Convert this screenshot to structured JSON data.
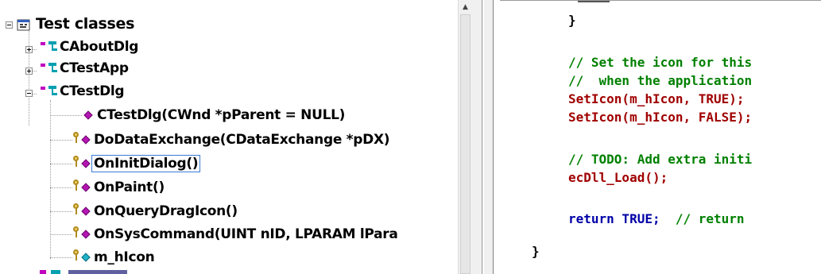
{
  "tree": {
    "root_label": "Test classes",
    "classes": [
      {
        "label": "CAboutDlg",
        "expanded": false
      },
      {
        "label": "CTestApp",
        "expanded": false
      },
      {
        "label": "CTestDlg",
        "expanded": true
      }
    ],
    "members": [
      {
        "label": "CTestDlg(CWnd *pParent = NULL)",
        "icon": "public-method-icon"
      },
      {
        "label": "DoDataExchange(CDataExchange *pDX)",
        "icon": "protected-method-icon"
      },
      {
        "label": "OnInitDialog()",
        "icon": "protected-method-icon",
        "selected": true
      },
      {
        "label": "OnPaint()",
        "icon": "protected-method-icon"
      },
      {
        "label": "OnQueryDragIcon()",
        "icon": "protected-method-icon"
      },
      {
        "label": "OnSysCommand(UINT nID, LPARAM lPara",
        "icon": "protected-method-icon"
      },
      {
        "label": "m_hIcon",
        "icon": "protected-variable-icon"
      }
    ]
  },
  "editor": {
    "lines": [
      {
        "text": "}",
        "kind": "plain"
      },
      {
        "text": "",
        "kind": "plain"
      },
      {
        "text": "// Set the icon for this",
        "kind": "comment"
      },
      {
        "text": "//  when the application",
        "kind": "comment"
      },
      {
        "text": "SetIcon(m_hIcon, TRUE);",
        "kind": "red"
      },
      {
        "text": "SetIcon(m_hIcon, FALSE);",
        "kind": "red"
      },
      {
        "text": "",
        "kind": "plain"
      },
      {
        "text": "// TODO: Add extra initi",
        "kind": "comment"
      },
      {
        "text": "ecDll_Load();",
        "kind": "red"
      },
      {
        "text": "",
        "kind": "plain"
      },
      {
        "text": "return TRUE;  // return",
        "kind": "mixed"
      },
      {
        "text": "}",
        "kind": "plain"
      }
    ],
    "return_keyword": "return TRUE;",
    "return_comment": "  // return"
  },
  "colors": {
    "comment": "#008000",
    "code": "#a00000",
    "keyword": "#0000a8",
    "method_icon": "#b515b5",
    "variable_icon": "#20b2c8"
  }
}
